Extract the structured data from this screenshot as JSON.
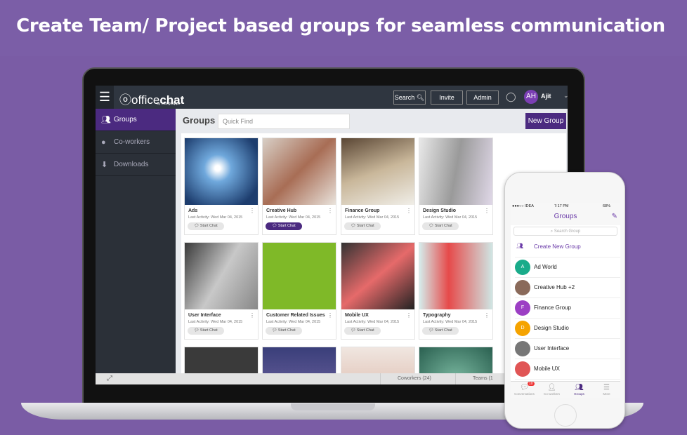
{
  "headline": "Create Team/ Project based groups for seamless communication",
  "app": {
    "logo_main": "office",
    "logo_bold": "chat",
    "logo_sub": "by Mangoapps",
    "search_label": "Search",
    "invite_label": "Invite",
    "admin_label": "Admin",
    "user_initials": "AH",
    "user_name": "Ajit"
  },
  "sidebar": {
    "items": [
      {
        "label": "Groups",
        "icon": "groups-icon"
      },
      {
        "label": "Co-workers",
        "icon": "person-icon"
      },
      {
        "label": "Downloads",
        "icon": "download-icon"
      }
    ]
  },
  "main": {
    "title": "Groups",
    "quick_find_placeholder": "Quick Find",
    "new_group_label": "New Group",
    "cards": [
      {
        "name": "Ads",
        "activity": "Last Activity: Wed Mar 04, 2015",
        "button": "Start Chat"
      },
      {
        "name": "Creative Hub",
        "activity": "Last Activity: Wed Mar 04, 2015",
        "button": "Start Chat"
      },
      {
        "name": "Finance Group",
        "activity": "Last Activity: Wed Mar 04, 2015",
        "button": "Start Chat"
      },
      {
        "name": "Design Studio",
        "activity": "Last Activity: Wed Mar 04, 2015",
        "button": "Start Chat"
      },
      {
        "name": "User Interface",
        "activity": "Last Activity: Wed Mar 04, 2015",
        "button": "Start Chat"
      },
      {
        "name": "Customer Related Issues",
        "activity": "Last Activity: Wed Mar 04, 2015",
        "button": "Start Chat"
      },
      {
        "name": "Mobile UX",
        "activity": "Last Activity: Wed Mar 04, 2015",
        "button": "Start Chat"
      },
      {
        "name": "Typography",
        "activity": "Last Activity: Wed Mar 04, 2015",
        "button": "Start Chat"
      }
    ]
  },
  "footer": {
    "coworkers": "Coworkers (24)",
    "teams": "Teams (1"
  },
  "phone": {
    "carrier": "●●●○○ IDEA",
    "time": "7:17 PM",
    "battery": "68%",
    "title": "Groups",
    "search_placeholder": "Search Group",
    "create_label": "Create New Group",
    "groups": [
      {
        "name": "Ad World",
        "initial": "A",
        "color": "#1aab8a"
      },
      {
        "name": "Creative Hub +2",
        "initial": "",
        "color": "#8a6a5a"
      },
      {
        "name": "Finance Group",
        "initial": "F",
        "color": "#9c3fc4"
      },
      {
        "name": "Design Studio",
        "initial": "D",
        "color": "#f5a300"
      },
      {
        "name": "User Interface",
        "initial": "",
        "color": "#777"
      },
      {
        "name": "Mobile UX",
        "initial": "",
        "color": "#e05555"
      }
    ],
    "tabs": [
      {
        "label": "Conversations",
        "badge": "10"
      },
      {
        "label": "Co-workers"
      },
      {
        "label": "Groups"
      },
      {
        "label": "More"
      }
    ]
  }
}
